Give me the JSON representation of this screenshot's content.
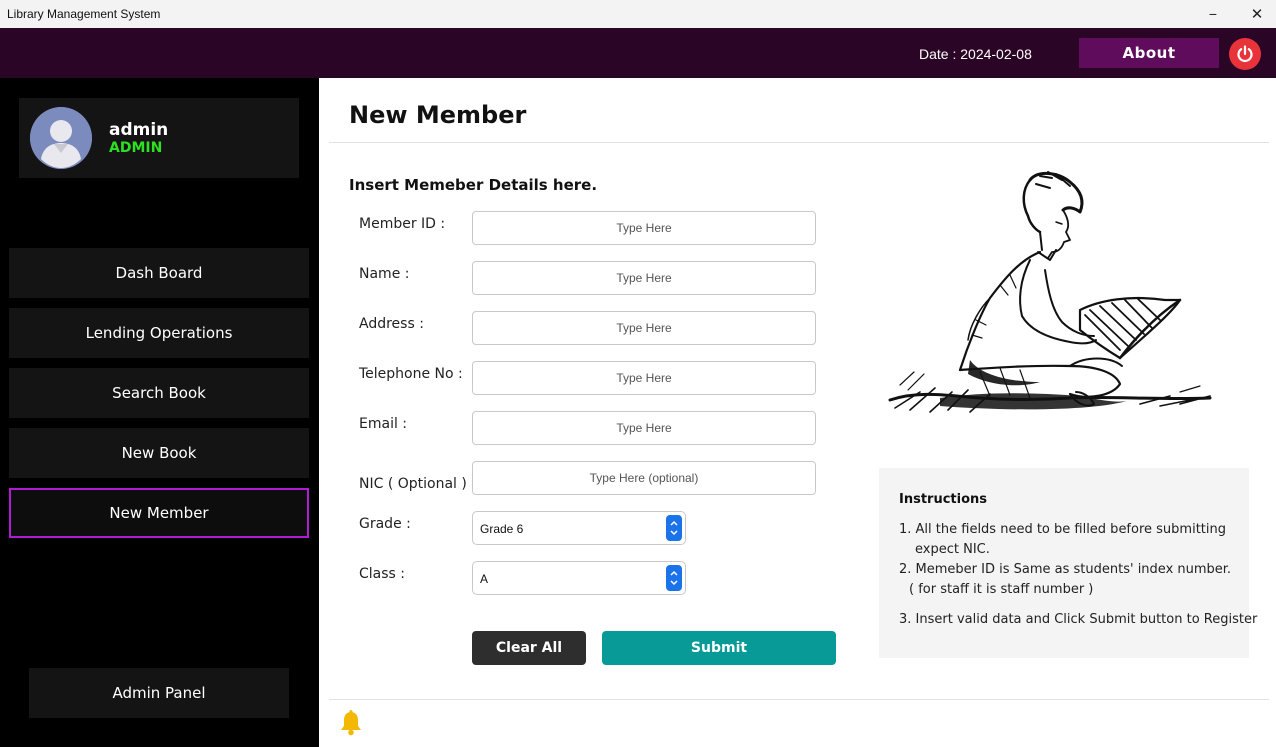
{
  "window": {
    "title": "Library Management System",
    "minimize_glyph": "−",
    "close_glyph": "✕"
  },
  "header": {
    "date": "Date : 2024-02-08",
    "about_label": "About",
    "power_icon": "power-icon",
    "bg_color": "#2b0526"
  },
  "profile": {
    "username": "admin",
    "role": "ADMIN",
    "role_color": "#2ee022"
  },
  "sidebar": {
    "items": [
      {
        "label": "Dash Board"
      },
      {
        "label": "Lending Operations"
      },
      {
        "label": "Search Book"
      },
      {
        "label": "New Book"
      },
      {
        "label": "New Member",
        "active": true
      }
    ],
    "admin_panel_label": "Admin Panel",
    "active_border_color": "#b21bd6"
  },
  "main": {
    "title": "New Member",
    "subtitle": "Insert Memeber Details here.",
    "fields": {
      "member_id": {
        "label": "Member ID :",
        "placeholder": "Type Here",
        "value": ""
      },
      "name": {
        "label": "Name :",
        "placeholder": "Type Here",
        "value": ""
      },
      "address": {
        "label": "Address :",
        "placeholder": "Type Here",
        "value": ""
      },
      "telephone": {
        "label": "Telephone No :",
        "placeholder": "Type Here",
        "value": ""
      },
      "email": {
        "label": "Email :",
        "placeholder": "Type Here",
        "value": ""
      },
      "nic": {
        "label": "NIC ( Optional ) :",
        "placeholder": "Type Here (optional)",
        "value": ""
      },
      "grade": {
        "label": "Grade :",
        "selected": "Grade 6"
      },
      "class": {
        "label": "Class :",
        "selected": "A"
      }
    },
    "buttons": {
      "clear_label": "Clear All",
      "submit_label": "Submit",
      "submit_color": "#079a96"
    }
  },
  "instructions": {
    "heading": "Instructions",
    "lines": [
      "1. All the fields need to be filled before submitting",
      "expect NIC.",
      "2. Memeber ID is Same as students' index number.",
      "( for staff it is staff number )",
      "3. Insert valid data and Click Submit button to Register"
    ]
  },
  "footer": {
    "bell_icon": "bell-icon"
  }
}
